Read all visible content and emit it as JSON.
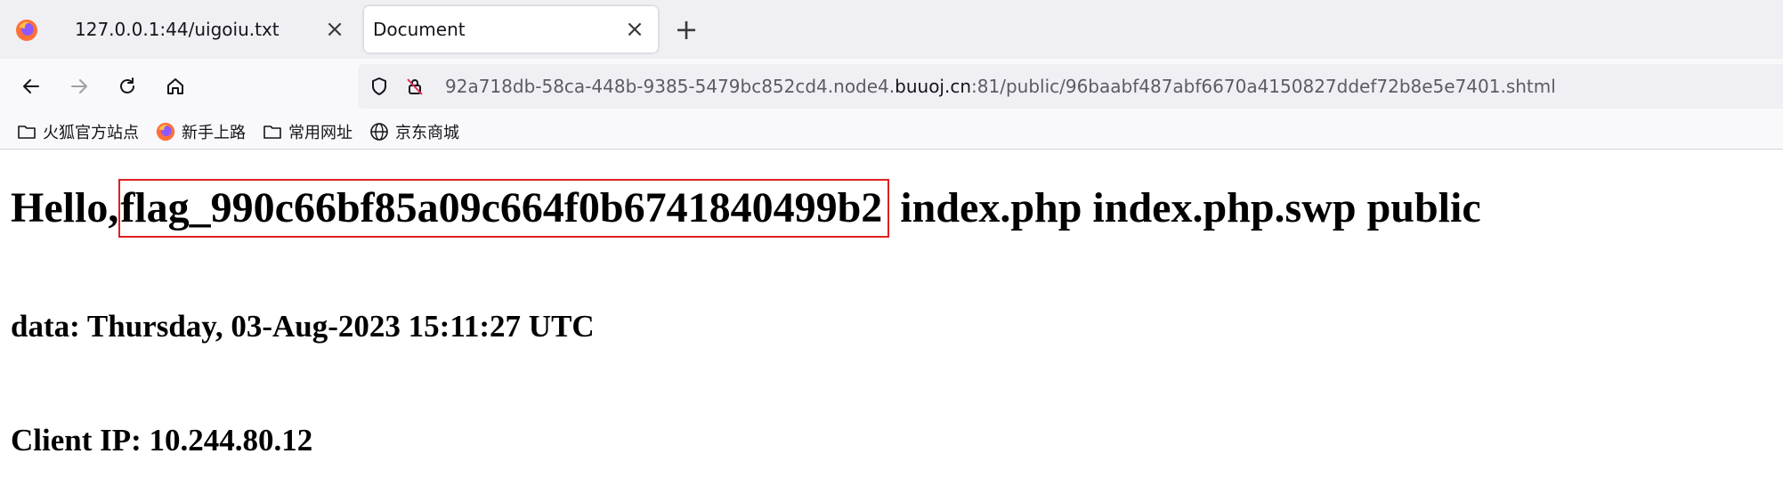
{
  "browser": {
    "tabs": [
      {
        "label": "127.0.0.1:44/uigoiu.txt",
        "active": false
      },
      {
        "label": "Document",
        "active": true
      }
    ],
    "new_tab_label": "+",
    "close_label": "×",
    "url": {
      "prefix": "92a718db-58ca-448b-9385-5479bc852cd4.node4.",
      "domain": "buuoj.cn",
      "suffix": ":81/public/96baabf487abf6670a4150827ddef72b8e5e7401.shtml"
    },
    "bookmarks": [
      {
        "label": "火狐官方站点",
        "icon": "folder-icon"
      },
      {
        "label": "新手上路",
        "icon": "firefox-icon"
      },
      {
        "label": "常用网址",
        "icon": "folder-icon"
      },
      {
        "label": "京东商城",
        "icon": "globe-icon"
      }
    ]
  },
  "page": {
    "hello_prefix": "Hello,",
    "flag": "flag_990c66bf85a09c664f0b6741840499b2",
    "hello_suffix": " index.php index.php.swp public",
    "date_line": "data: Thursday, 03-Aug-2023 15:11:27 UTC",
    "ip_line": "Client IP: 10.244.80.12"
  },
  "colors": {
    "highlight_box": "#e02020"
  }
}
